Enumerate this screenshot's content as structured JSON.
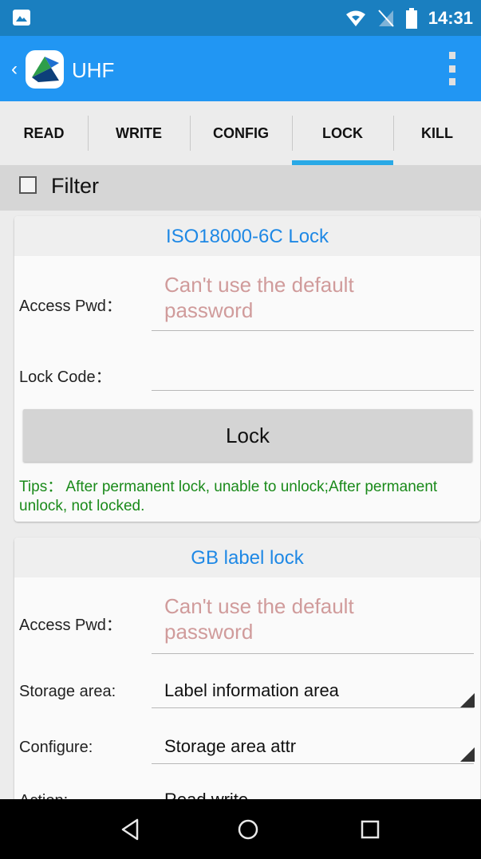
{
  "status_bar": {
    "time": "14:31",
    "icons": [
      "image-icon",
      "wifi-icon",
      "no-sim-icon",
      "battery-icon"
    ]
  },
  "app_bar": {
    "title": "UHF",
    "icons": [
      "back-icon",
      "app-logo-icon",
      "overflow-menu-icon"
    ]
  },
  "tabs": [
    {
      "label": "READ"
    },
    {
      "label": "WRITE"
    },
    {
      "label": "CONFIG"
    },
    {
      "label": "LOCK",
      "selected": true
    },
    {
      "label": "KILL"
    }
  ],
  "filter": {
    "label": "Filter",
    "checked": false
  },
  "iso_card": {
    "title": "ISO18000-6C Lock",
    "access_pwd_label": "Access Pwd：",
    "access_pwd_placeholder": "Can't use the default password",
    "lock_code_label": "Lock Code：",
    "lock_button": "Lock",
    "tips": "Tips： After permanent lock, unable to unlock;After permanent unlock, not locked."
  },
  "gb_card": {
    "title": "GB label lock",
    "access_pwd_label": "Access Pwd：",
    "access_pwd_placeholder": "Can't use the default password",
    "storage_area_label": "Storage area:",
    "storage_area_value": "Label information area",
    "configure_label": "Configure:",
    "configure_value": "Storage area attr",
    "action_label": "Action:",
    "action_value": "Read write"
  },
  "colors": {
    "status_bar": "#1a7fc0",
    "app_bar": "#2196f3",
    "tab_indicator": "#29a9e6",
    "card_title": "#1e88e5",
    "placeholder": "#d09b9b",
    "tips": "#1a8a1a"
  },
  "nav_bar": {
    "icons": [
      "back-triangle-icon",
      "home-circle-icon",
      "recents-square-icon"
    ]
  }
}
